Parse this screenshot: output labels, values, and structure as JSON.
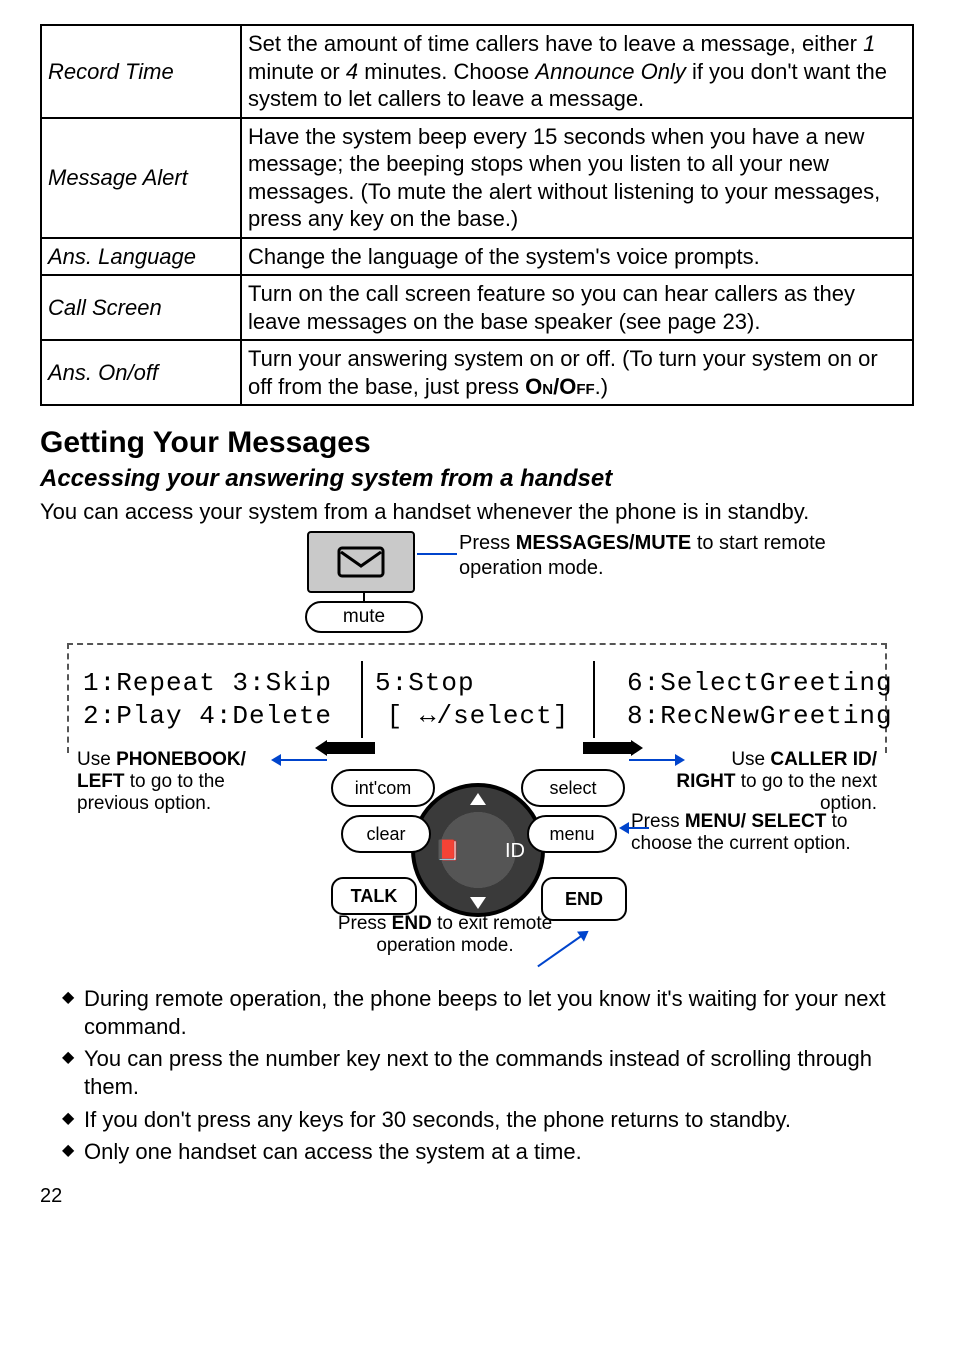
{
  "table": {
    "rows": [
      {
        "name": "Record Time",
        "desc_parts": [
          "Set the amount of time callers have to leave a message, either ",
          "1",
          " minute or ",
          "4",
          " minutes. Choose ",
          "Announce Only",
          " if you don't want the system to let callers to leave a message."
        ]
      },
      {
        "name": "Message Alert",
        "desc": "Have the system beep every 15 seconds when you have a new message; the beeping stops when you listen to all your new messages. (To mute the alert without listening to your messages, press any key on the base.)"
      },
      {
        "name": "Ans. Language",
        "desc": "Change the language of the system's voice prompts."
      },
      {
        "name": "Call Screen",
        "desc": "Turn on the call screen feature so you can hear callers as they leave messages on the base speaker (see page 23)."
      },
      {
        "name": "Ans. On/off",
        "desc_parts": [
          "Turn your answering system on or off. (To turn your system on or off from the base, just press ",
          "On/Off",
          ".)"
        ]
      }
    ]
  },
  "section_title": "Getting Your Messages",
  "subsection_title": "Accessing your answering system from a handset",
  "intro": "You can access your system from a handset whenever the phone is in standby.",
  "diagram": {
    "msg_instruction_prefix": "Press ",
    "msg_instruction_key": "MESSAGES/MUTE",
    "msg_instruction_suffix": " to start remote operation mode.",
    "mute_label": "mute",
    "lcd_left_line1": "1:Repeat 3:Skip",
    "lcd_left_line2": "2:Play   4:Delete",
    "lcd_mid_line1": "5:Stop",
    "lcd_mid_line2": "[ ↔/select]",
    "lcd_right_line1": "6:SelectGreeting",
    "lcd_right_line2": "8:RecNewGreeting",
    "hint_left_prefix": "Use ",
    "hint_left_key": "PHONEBOOK/ LEFT",
    "hint_left_suffix": " to go to the previous option.",
    "hint_right_prefix": "Use ",
    "hint_right_key": "CALLER ID/ RIGHT",
    "hint_right_suffix": " to go to the next option.",
    "menu_hint_prefix": "Press ",
    "menu_hint_key": "MENU/ SELECT",
    "menu_hint_suffix": " to choose the current option.",
    "end_hint_prefix": "Press ",
    "end_hint_key": "END",
    "end_hint_suffix": " to exit remote operation mode.",
    "btn_intcom": "int'com",
    "btn_select": "select",
    "btn_clear": "clear",
    "btn_menu": "menu",
    "btn_talk": "TALK",
    "btn_end": "END"
  },
  "bullets": [
    "During remote operation, the phone beeps to let you know it's waiting for your next command.",
    "You can press the number key next to the commands instead of scrolling through them.",
    "If you don't press any keys for 30 seconds, the phone returns to standby.",
    "Only one handset can access the system at a time."
  ],
  "page_number": "22"
}
